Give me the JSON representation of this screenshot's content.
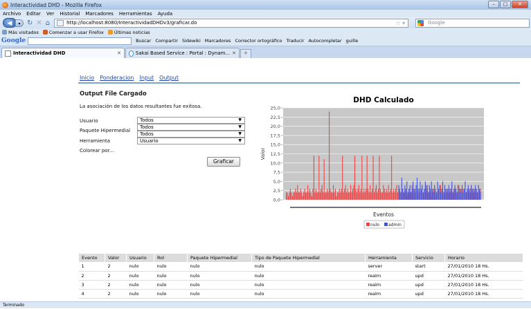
{
  "window": {
    "title": "Interactividad DHD - Mozilla Firefox"
  },
  "menu": [
    "Archivo",
    "Editar",
    "Ver",
    "Historial",
    "Marcadores",
    "Herramientas",
    "Ayuda"
  ],
  "nav": {
    "url": "http://localhost:8080/InteractividadDHDv3/graficar.do",
    "search_placeholder": "Google"
  },
  "bookmarks": [
    "Más visitados",
    "Comenzar a usar Firefox",
    "Últimas noticias"
  ],
  "google_toolbar": {
    "logo": "Google",
    "items": [
      "Buscar",
      "Compartir",
      "Sidewiki",
      "Marcadores",
      "Corrector ortográfico",
      "Traducir",
      "Autocompletar",
      "guille"
    ]
  },
  "tabs": [
    {
      "label": "Interactividad DHD"
    },
    {
      "label": "Sakai Based Service : Portal : Dynam..."
    }
  ],
  "app": {
    "nav": [
      "Inicio",
      "Ponderacion",
      "Input",
      "Output"
    ],
    "heading": "Output File Cargado",
    "message": "La asociación de los datos resultantes fue exitosa.",
    "filters": [
      {
        "label": "Usuario",
        "value": "Todos"
      },
      {
        "label": "Paquete Hipermedial",
        "value": "Todos"
      },
      {
        "label": "",
        "value": "Todos"
      },
      {
        "label": "Herramienta",
        "value": "Usuario"
      }
    ],
    "color_label": "Colorear por...",
    "button": "Graficar"
  },
  "chart_data": {
    "type": "bar",
    "title": "DHD Calculado",
    "xlabel": "Eventos",
    "ylabel": "Valor",
    "ylim": [
      0,
      25
    ],
    "yticks": [
      "0,0",
      "2,5",
      "5,0",
      "7,5",
      "10,0",
      "12,5",
      "15,0",
      "17,5",
      "20,0",
      "22,5",
      "25,0"
    ],
    "grid": true,
    "legend_position": "bottom",
    "series": [
      {
        "name": "nulo",
        "color": "#ee4444",
        "values": [
          2,
          2,
          1,
          2,
          3,
          2,
          1,
          2,
          2,
          3,
          2,
          4,
          2,
          2,
          3,
          2,
          1,
          2,
          3,
          2,
          2,
          4,
          2,
          3,
          2,
          1,
          3,
          12,
          2,
          3,
          2,
          2,
          12,
          2,
          3,
          4,
          2,
          11,
          2,
          2,
          3,
          2,
          24,
          3,
          2,
          2,
          4,
          2,
          3,
          1,
          2,
          2,
          3,
          2,
          3,
          12,
          2,
          3,
          4,
          2,
          3,
          2,
          2,
          4,
          2,
          3,
          4,
          12,
          3,
          2,
          3,
          4,
          2,
          3,
          12,
          2,
          3,
          2,
          3,
          12,
          3,
          2,
          4,
          2,
          3,
          12,
          2,
          3,
          4,
          2,
          3,
          12,
          3,
          2,
          2,
          4,
          3,
          2,
          3,
          2,
          4,
          2,
          3,
          12,
          2,
          3,
          2,
          3,
          4,
          2,
          3,
          3,
          2,
          4,
          3,
          2,
          3,
          2,
          1,
          2,
          3,
          2,
          2,
          4,
          2,
          3,
          3,
          2,
          4,
          2,
          3,
          2,
          3,
          4,
          2,
          3,
          2,
          3,
          4,
          2,
          3,
          2,
          1,
          2,
          3,
          2,
          1,
          2,
          3,
          2,
          3,
          4,
          2,
          3,
          2,
          3,
          2,
          3,
          2,
          2,
          3,
          2,
          4,
          2,
          3,
          2,
          3,
          2,
          2,
          4,
          3,
          2,
          2,
          3,
          2,
          4,
          2,
          3,
          2,
          2,
          3,
          4,
          2,
          3,
          2,
          2,
          3,
          2,
          4,
          2,
          3
        ]
      },
      {
        "name": "admin",
        "color": "#4455dd",
        "values": [
          0,
          0,
          0,
          0,
          0,
          0,
          0,
          0,
          0,
          0,
          0,
          0,
          0,
          0,
          0,
          0,
          0,
          0,
          0,
          0,
          0,
          0,
          0,
          0,
          0,
          0,
          0,
          0,
          0,
          0,
          0,
          0,
          0,
          0,
          0,
          0,
          0,
          0,
          0,
          0,
          0,
          0,
          0,
          0,
          0,
          0,
          0,
          0,
          0,
          0,
          0,
          0,
          0,
          0,
          0,
          0,
          0,
          0,
          0,
          0,
          0,
          0,
          0,
          0,
          0,
          0,
          0,
          0,
          0,
          0,
          0,
          0,
          0,
          0,
          0,
          0,
          0,
          0,
          0,
          0,
          0,
          0,
          0,
          0,
          0,
          0,
          0,
          0,
          0,
          0,
          0,
          0,
          0,
          0,
          0,
          0,
          0,
          0,
          0,
          0,
          0,
          0,
          0,
          0,
          0,
          0,
          0,
          0,
          0,
          0,
          4,
          3,
          2,
          6,
          3,
          2,
          4,
          3,
          5,
          2,
          3,
          4,
          2,
          3,
          5,
          3,
          2,
          4,
          6,
          3,
          2,
          5,
          3,
          4,
          2,
          3,
          5,
          4,
          3,
          2,
          4,
          3,
          5,
          3,
          2,
          4,
          3,
          2,
          5,
          3,
          4,
          2,
          3,
          5,
          2,
          4,
          3,
          2,
          3,
          4,
          2,
          3,
          5,
          2,
          3,
          4,
          3,
          2,
          4,
          3,
          2,
          3,
          4,
          2,
          3,
          5,
          2,
          3,
          4,
          3,
          2,
          4,
          3,
          2,
          3,
          4,
          3,
          2,
          4,
          3,
          2
        ]
      }
    ]
  },
  "table": {
    "columns": [
      "Evento",
      "Valor",
      "Usuario",
      "Rol",
      "Paquete Hipermedial",
      "Tipo de Paquete Hipermedial",
      "Herramienta",
      "Servicio",
      "Horario"
    ],
    "rows": [
      [
        "1",
        "2",
        "nulo",
        "nulo",
        "nulo",
        "nulo",
        "server",
        "start",
        "27/01/2010 18 Hs."
      ],
      [
        "2",
        "2",
        "nulo",
        "nulo",
        "nulo",
        "nulo",
        "realm",
        "upd",
        "27/01/2010 18 Hs."
      ],
      [
        "3",
        "2",
        "nulo",
        "nulo",
        "nulo",
        "nulo",
        "realm",
        "upd",
        "27/01/2010 18 Hs."
      ],
      [
        "4",
        "2",
        "nulo",
        "nulo",
        "nulo",
        "nulo",
        "realm",
        "upd",
        "27/01/2010 18 Hs."
      ]
    ]
  },
  "status": "Terminado"
}
